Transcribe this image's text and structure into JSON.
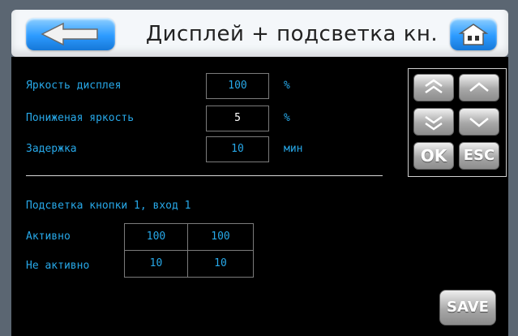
{
  "header": {
    "title": "Дисплей + подсветка кн."
  },
  "display": {
    "brightness": {
      "label": "Яркость дисплея",
      "value": "100",
      "unit": "%"
    },
    "low_brightness": {
      "label": "Пониженая яркость",
      "value": "5",
      "unit": "%"
    },
    "delay": {
      "label": "Задержка",
      "value": "10",
      "unit": "мин"
    }
  },
  "keypad": {
    "ok": "OK",
    "esc": "ESC"
  },
  "backlight": {
    "title": "Подсветка кнопки 1, вход 1",
    "active": {
      "label": "Активно",
      "v1": "100",
      "v2": "100"
    },
    "inactive": {
      "label": "Не активно",
      "v1": "10",
      "v2": "10"
    }
  },
  "save_label": "SAVE",
  "colors": {
    "label_blue": "#27a8e8",
    "accent_blue": "#2d9bff"
  }
}
